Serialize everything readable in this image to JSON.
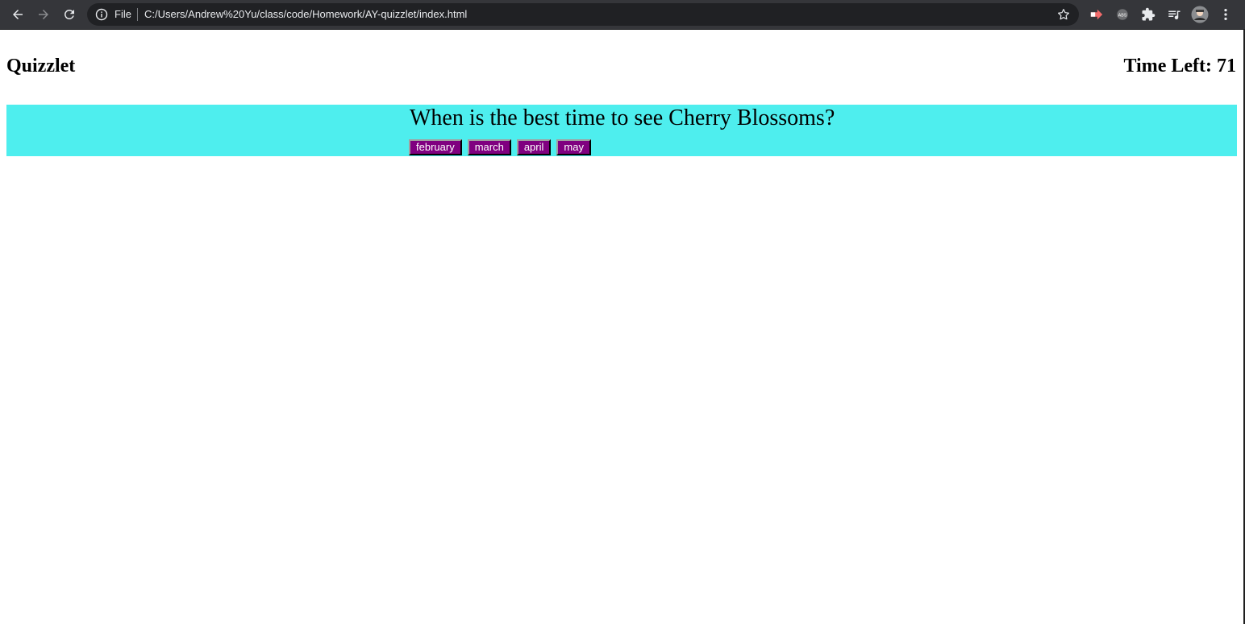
{
  "browser": {
    "scheme_label": "File",
    "url": "C:/Users/Andrew%20Yu/class/code/Homework/AY-quizzlet/index.html",
    "icons": [
      "back-arrow-icon",
      "forward-arrow-icon",
      "reload-icon",
      "info-icon",
      "star-icon",
      "extension-icon",
      "adblock-icon",
      "puzzle-icon",
      "media-queue-icon",
      "profile-avatar",
      "menu-dots-icon"
    ]
  },
  "page": {
    "title": "Quizzlet",
    "timer_label": "Time Left: 71",
    "question": "When is the best time to see Cherry Blossoms?",
    "choices": [
      "february",
      "march",
      "april",
      "may"
    ]
  },
  "colors": {
    "quiz_background": "#4eeeee",
    "choice_button": "#800080",
    "chrome_bar": "#35363a"
  }
}
